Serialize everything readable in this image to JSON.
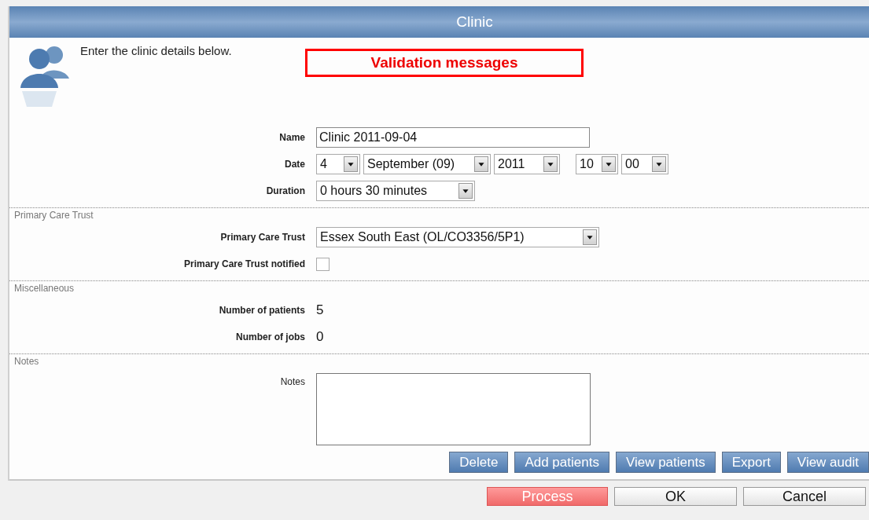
{
  "window": {
    "title": "Clinic"
  },
  "intro": {
    "text": "Enter the clinic details below."
  },
  "validation": {
    "text": "Validation messages"
  },
  "sections": [
    {
      "fields": [
        {
          "kind": "text",
          "label": "Name",
          "bold": true,
          "value": "Clinic 2011-09-04"
        },
        {
          "kind": "date",
          "label": "Date",
          "bold": true,
          "parts": [
            "4",
            "September (09)",
            "2011"
          ],
          "time": [
            "10",
            "00"
          ]
        },
        {
          "kind": "select",
          "label": "Duration",
          "bold": true,
          "value": "0 hours 30 minutes"
        }
      ]
    },
    {
      "title": "Primary Care Trust",
      "fields": [
        {
          "kind": "select",
          "label": "Primary Care Trust",
          "bold": true,
          "value": "Essex South East (OL/CO3356/5P1)"
        },
        {
          "kind": "checkbox",
          "label": "Primary Care Trust notified",
          "bold": true,
          "checked": false
        }
      ]
    },
    {
      "title": "Miscellaneous",
      "fields": [
        {
          "kind": "readonly",
          "label": "Number of patients",
          "bold": true,
          "value": "5"
        },
        {
          "kind": "readonly",
          "label": "Number of jobs",
          "bold": true,
          "value": "0"
        }
      ]
    },
    {
      "title": "Notes",
      "fields": [
        {
          "kind": "textarea",
          "label": "Notes",
          "bold": false
        }
      ]
    }
  ],
  "actions": [
    "Delete",
    "Add patients",
    "View patients",
    "Export",
    "View audit"
  ],
  "footer": [
    {
      "label": "Process",
      "kind": "primary"
    },
    {
      "label": "OK",
      "kind": "default"
    },
    {
      "label": "Cancel",
      "kind": "default"
    }
  ]
}
